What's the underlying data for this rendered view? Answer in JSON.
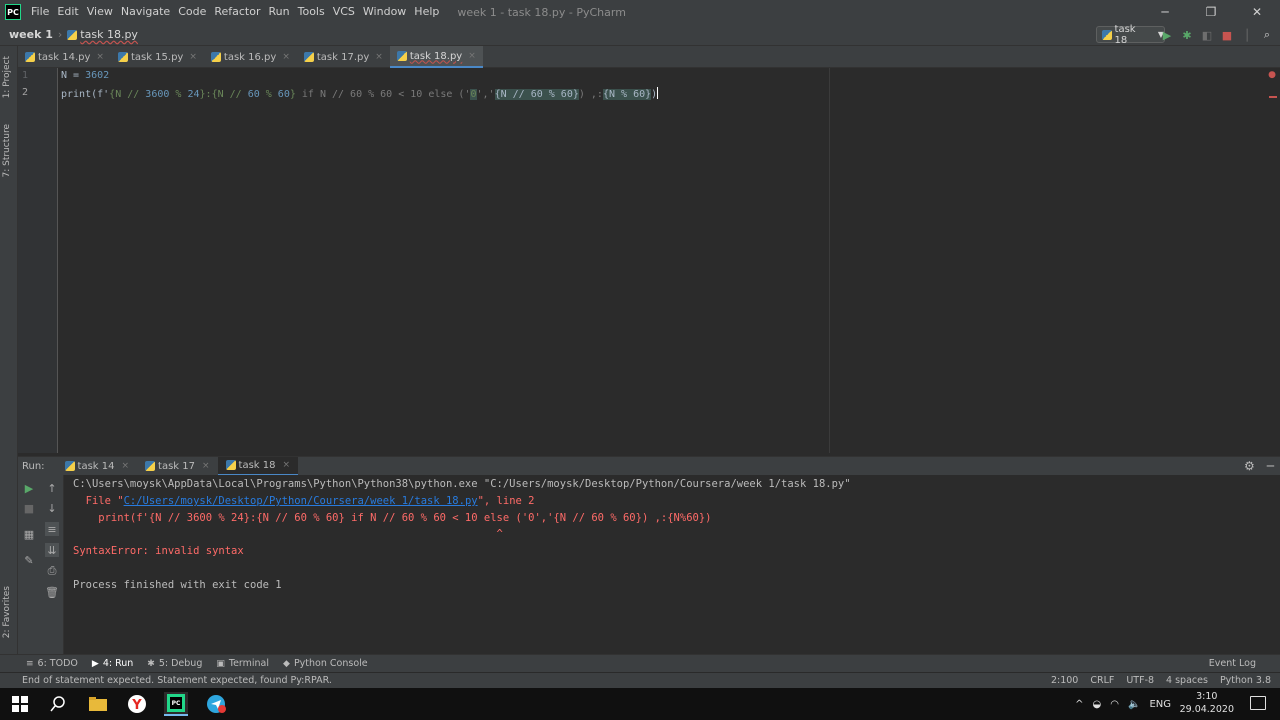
{
  "window": {
    "title": "week 1 - task 18.py - PyCharm",
    "logo_text": "PC",
    "controls": [
      "─",
      "❐",
      "✕"
    ]
  },
  "menu": [
    "File",
    "Edit",
    "View",
    "Navigate",
    "Code",
    "Refactor",
    "Run",
    "Tools",
    "VCS",
    "Window",
    "Help"
  ],
  "breadcrumb": {
    "project": "week 1",
    "file": "task 18.py"
  },
  "run_config": {
    "label": "task 18"
  },
  "editor_tabs": [
    {
      "label": "task 14.py",
      "close": "×"
    },
    {
      "label": "task 15.py",
      "close": "×"
    },
    {
      "label": "task 16.py",
      "close": "×"
    },
    {
      "label": "task 17.py",
      "close": "×"
    },
    {
      "label": "task 18.py",
      "close": "×"
    }
  ],
  "left_strip": {
    "project": "1: Project",
    "structure": "7: Structure",
    "favorites": "2: Favorites"
  },
  "editor": {
    "line_numbers": [
      "1",
      "2"
    ],
    "line1": {
      "a": "N = ",
      "b": "3602"
    },
    "line2": {
      "p1": "print(f'",
      "p2": "{N // ",
      "p3": "3600",
      "p4": " % ",
      "p5": "24",
      "p6": "}",
      "p7": ":",
      "p8": "{N // ",
      "p9": "60",
      "p10": " % ",
      "p11": "60",
      "p12": "}",
      "p13": " if N // 60 % 60 < 10 else ('",
      "p14": "0",
      "p15": "','",
      "p16": "{N // 60 % 60}",
      "p17": ") ,:",
      "p18": "{N % 60}",
      "p19": ")"
    }
  },
  "run_panel": {
    "label": "Run:",
    "tabs": [
      {
        "label": "task 14",
        "close": "×"
      },
      {
        "label": "task 17",
        "close": "×"
      },
      {
        "label": "task 18",
        "close": "×"
      }
    ]
  },
  "console": {
    "cmd": "C:\\Users\\moysk\\AppData\\Local\\Programs\\Python\\Python38\\python.exe \"C:/Users/moysk/Desktop/Python/Coursera/week 1/task 18.py\"",
    "file_prefix": "  File \"",
    "file_link": "C:/Users/moysk/Desktop/Python/Coursera/week 1/task 18.py",
    "file_suffix": "\", line 2",
    "src": "    print(f'{N // 3600 % 24}:{N // 60 % 60} if N // 60 % 60 < 10 else ('0','{N // 60 % 60}) ,:{N%60})",
    "caret": "                                                                   ^",
    "error": "SyntaxError: invalid syntax",
    "finished": "Process finished with exit code 1"
  },
  "tool_tabs": [
    {
      "label": "6: TODO",
      "icon": "≡"
    },
    {
      "label": "4: Run",
      "icon": "▶"
    },
    {
      "label": "5: Debug",
      "icon": "✱"
    },
    {
      "label": "Terminal",
      "icon": "▣"
    },
    {
      "label": "Python Console",
      "icon": "◆"
    }
  ],
  "event_log": "Event Log",
  "status": {
    "message": "End of statement expected. Statement expected, found Py:RPAR.",
    "position": "2:100",
    "line_sep": "CRLF",
    "encoding": "UTF-8",
    "indent": "4 spaces",
    "interpreter": "Python 3.8"
  },
  "taskbar": {
    "lang": "ENG",
    "time": "3:10",
    "date": "29.04.2020"
  },
  "colors": {
    "accent": "#4a88c7",
    "error": "#ff6b68",
    "run_green": "#59a869",
    "stop_red": "#c75450"
  }
}
